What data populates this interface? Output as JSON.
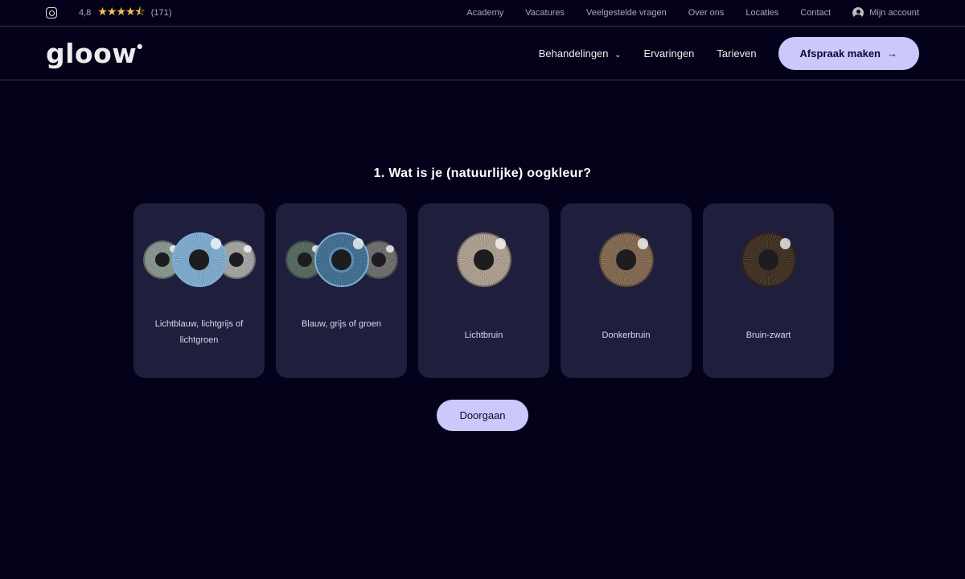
{
  "topbar": {
    "rating": "4,8",
    "stars": "★★★★⯪",
    "reviews": "(171)",
    "links": [
      "Academy",
      "Vacatures",
      "Veelgestelde vragen",
      "Over ons",
      "Locaties",
      "Contact"
    ],
    "account": "Mijn account"
  },
  "header": {
    "logo": "gloow",
    "nav": [
      "Behandelingen",
      "Ervaringen",
      "Tarieven"
    ],
    "cta": "Afspraak maken"
  },
  "question": "1. Wat is je (natuurlijke) oogkleur?",
  "options": [
    {
      "label": "Lichtblauw, lichtgrijs of lichtgroen",
      "eyes": [
        "#8a9a93",
        "#7fb0d6",
        "#a9a9a9"
      ]
    },
    {
      "label": "Blauw, grijs of groen",
      "eyes": [
        "#55695f",
        "#3f6f94",
        "#6e6e6e"
      ]
    },
    {
      "label": "Lichtbruin",
      "eyes": [
        "#b3a493"
      ]
    },
    {
      "label": "Donkerbruin",
      "eyes": [
        "#85694f"
      ]
    },
    {
      "label": "Bruin-zwart",
      "eyes": [
        "#3c2c1c"
      ]
    }
  ],
  "continue": "Doorgaan"
}
